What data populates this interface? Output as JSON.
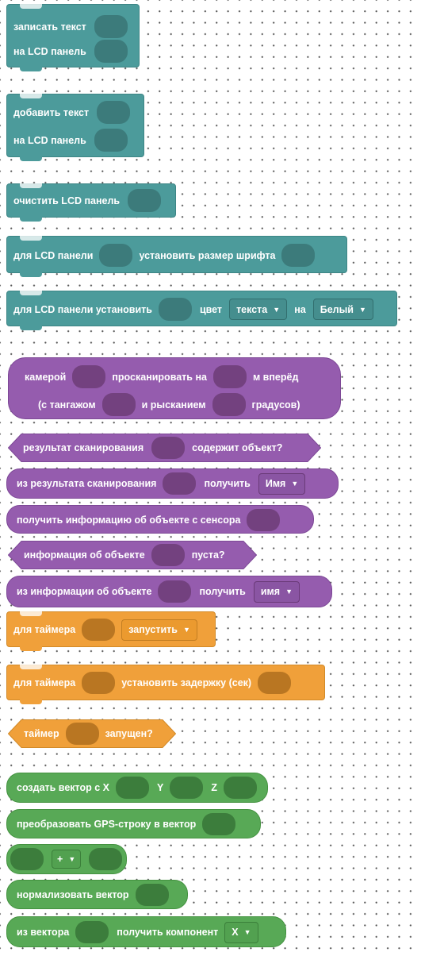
{
  "lcd": {
    "write_text": {
      "line1": "записать текст",
      "line2": "на LCD панель"
    },
    "add_text": {
      "line1": "добавить текст",
      "line2": "на LCD панель"
    },
    "clear": {
      "label": "очистить LCD панель"
    },
    "font_size": {
      "part1": "для LCD панели",
      "part2": "установить размер шрифта"
    },
    "set_color": {
      "part1": "для LCD панели установить",
      "part2": "цвет",
      "dropdown1": "текста",
      "part3": "на",
      "dropdown2": "Белый"
    }
  },
  "camera": {
    "scan": {
      "part1": "камерой",
      "part2": "просканировать на",
      "part3": "м вперёд",
      "part4": "(с тангажом",
      "part5": "и рысканием",
      "part6": "градусов)"
    },
    "scan_contains": {
      "part1": "результат сканирования",
      "part2": "содержит объект?"
    },
    "scan_get": {
      "part1": "из результата сканирования",
      "part2": "получить",
      "dropdown": "Имя"
    },
    "sensor_info": {
      "label": "получить информацию об объекте с сенсора"
    },
    "info_empty": {
      "part1": "информация об объекте",
      "part2": "пуста?"
    },
    "info_get": {
      "part1": "из информации об объекте",
      "part2": "получить",
      "dropdown": "имя"
    }
  },
  "timer": {
    "start": {
      "part1": "для таймера",
      "dropdown": "запустить"
    },
    "delay": {
      "part1": "для таймера",
      "part2": "установить задержку (сек)"
    },
    "running": {
      "part1": "таймер",
      "part2": "запущен?"
    }
  },
  "vector": {
    "create": {
      "part1": "создать вектор с X",
      "part2": "Y",
      "part3": "Z"
    },
    "from_gps": {
      "label": "преобразовать GPS-строку в вектор"
    },
    "op": {
      "dropdown": "+"
    },
    "normalize": {
      "label": "нормализовать вектор"
    },
    "component": {
      "part1": "из вектора",
      "part2": "получить компонент",
      "dropdown": "X"
    }
  },
  "caret": "▼",
  "colors": {
    "lcd": "#4c9b9b",
    "camera": "#955cae",
    "timer": "#f0a03a",
    "vector": "#58a956"
  }
}
